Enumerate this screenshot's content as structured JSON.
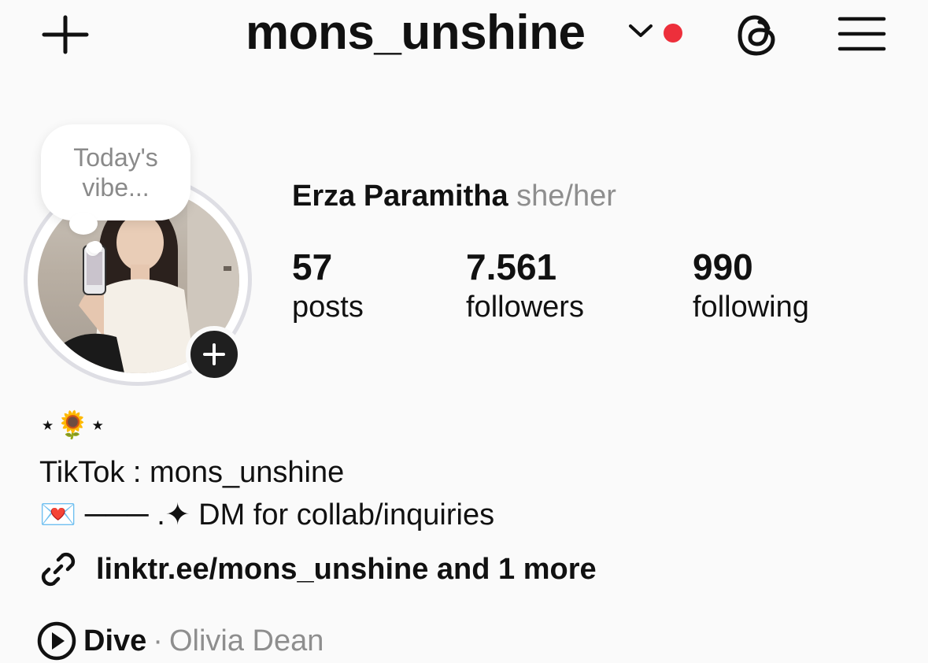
{
  "header": {
    "username": "mons_unshine",
    "notification_color": "#ed2f3b",
    "icons": [
      "plus-icon",
      "chevron-down-icon",
      "threads-icon",
      "menu-icon"
    ]
  },
  "profile": {
    "note": "Today's vibe...",
    "full_name": "Erza Paramitha",
    "pronouns": "she/her",
    "stats": [
      {
        "value": "57",
        "label": "posts"
      },
      {
        "value": "7.561",
        "label": "followers"
      },
      {
        "value": "990",
        "label": "following"
      }
    ]
  },
  "bio": {
    "emoji_line": "⋆🌻⋆",
    "line1": "TikTok : mons_unshine",
    "line2": "💌 ─── .✦ DM for collab/inquiries",
    "link": "linktr.ee/mons_unshine and 1 more"
  },
  "music": {
    "song": "Dive",
    "separator": "·",
    "artist": "Olivia Dean"
  }
}
